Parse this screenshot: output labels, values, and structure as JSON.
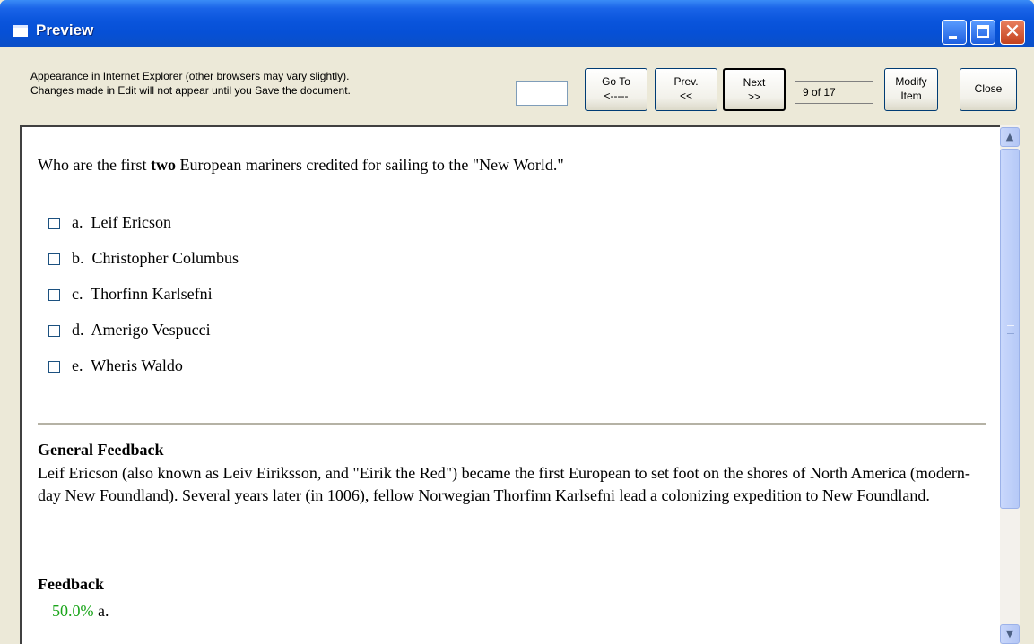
{
  "window": {
    "title": "Preview",
    "minimize_icon": "minimize-icon",
    "maximize_icon": "maximize-icon",
    "close_icon": "close-x-icon",
    "close_glyph": "✕"
  },
  "toolbar": {
    "info_line1": "Appearance in Internet Explorer (other browsers may vary slightly).",
    "info_line2": "Changes made in Edit will not appear until you Save the document.",
    "goto_value": "",
    "goto_label1": "Go To",
    "goto_label2": "<-----",
    "prev_label1": "Prev.",
    "prev_label2": "<<",
    "next_label1": "Next",
    "next_label2": ">>",
    "counter": "9 of 17",
    "modify_label1": "Modify",
    "modify_label2": "Item",
    "close_label": "Close"
  },
  "question": {
    "text_before": "Who are the first ",
    "text_bold": "two",
    "text_after": " European mariners credited for sailing to the \"New World.\"",
    "choices": [
      {
        "letter": "a.",
        "text": "Leif Ericson",
        "checked": false
      },
      {
        "letter": "b.",
        "text": "Christopher Columbus",
        "checked": false
      },
      {
        "letter": "c.",
        "text": "Thorfinn Karlsefni",
        "checked": false
      },
      {
        "letter": "d.",
        "text": "Amerigo Vespucci",
        "checked": false
      },
      {
        "letter": "e.",
        "text": "Wheris Waldo",
        "checked": false
      }
    ]
  },
  "general_feedback": {
    "title": "General Feedback",
    "body": "Leif Ericson (also known as Leiv Eiriksson, and \"Eirik the Red\") became the first European to set foot on the shores of North America (modern-day New Foundland). Several years later (in 1006), fellow Norwegian Thorfinn Karlsefni lead a colonizing expedition to New Foundland."
  },
  "feedback": {
    "title": "Feedback",
    "percent": "50.0%",
    "choice": "a."
  },
  "scrollbar": {
    "up_glyph": "▲",
    "down_glyph": "▼"
  },
  "colors": {
    "title_bar": "#0a55dc",
    "feedback_percent": "#1aa51a",
    "window_bg": "#ece9d8"
  }
}
